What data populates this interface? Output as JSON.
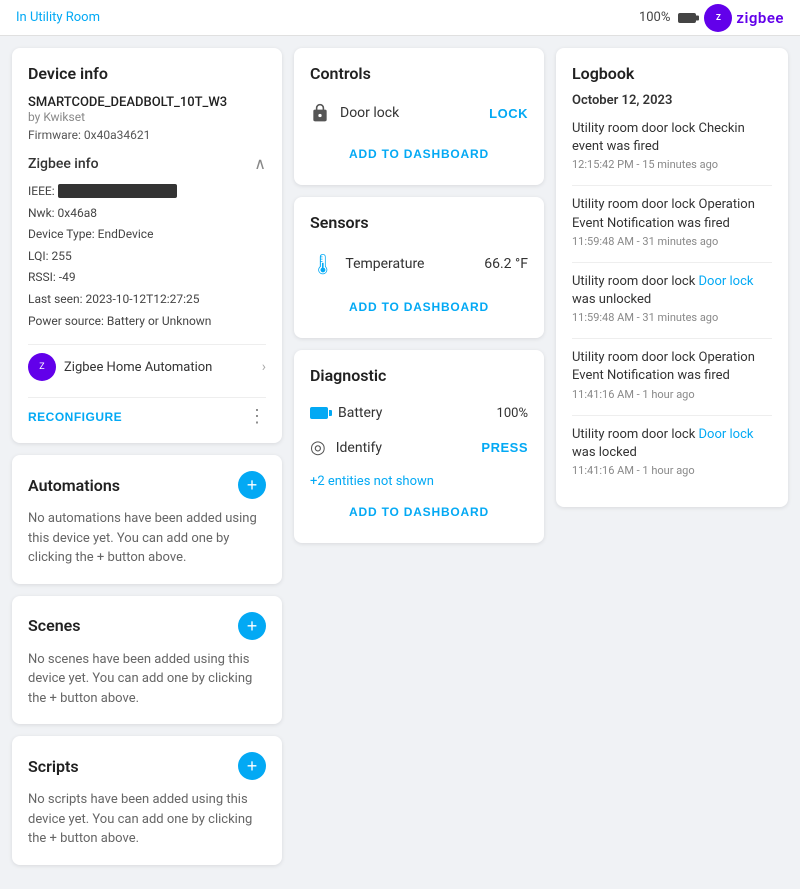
{
  "topbar": {
    "breadcrumb": "In Utility Room",
    "battery_pct": "100%",
    "zigbee_label": "zigbee"
  },
  "device_info": {
    "title": "Device info",
    "device_name": "SMARTCODE_DEADBOLT_10T_W3",
    "by": "by Kwikset",
    "firmware_label": "Firmware: 0x40a34621",
    "zigbee_info_title": "Zigbee info",
    "ieee_label": "IEEE:",
    "ieee_value": "██████████████",
    "nwk": "Nwk: 0x46a8",
    "device_type": "Device Type: EndDevice",
    "lqi": "LQI: 255",
    "rssi": "RSSI: -49",
    "last_seen": "Last seen: 2023-10-12T12:27:25",
    "power_source": "Power source: Battery or Unknown",
    "zigbee_home_label": "Zigbee Home Automation",
    "reconfigure_label": "RECONFIGURE"
  },
  "automations": {
    "title": "Automations",
    "empty_text": "No automations have been added using this device yet. You can add one by clicking the + button above."
  },
  "scenes": {
    "title": "Scenes",
    "empty_text": "No scenes have been added using this device yet. You can add one by clicking the + button above."
  },
  "scripts": {
    "title": "Scripts",
    "empty_text": "No scripts have been added using this device yet. You can add one by clicking the + button above."
  },
  "controls": {
    "title": "Controls",
    "door_lock_label": "Door lock",
    "lock_action": "LOCK",
    "add_dashboard": "ADD TO DASHBOARD"
  },
  "sensors": {
    "title": "Sensors",
    "temperature_label": "Temperature",
    "temperature_value": "66.2 °F",
    "add_dashboard": "ADD TO DASHBOARD"
  },
  "diagnostic": {
    "title": "Diagnostic",
    "battery_label": "Battery",
    "battery_value": "100%",
    "identify_label": "Identify",
    "press_action": "PRESS",
    "entities_link": "+2 entities not shown",
    "add_dashboard": "ADD TO DASHBOARD"
  },
  "logbook": {
    "title": "Logbook",
    "date": "October 12, 2023",
    "entries": [
      {
        "text_parts": [
          "Utility room door lock Checkin event was fired"
        ],
        "highlight": "",
        "time": "12:15:42 PM - 15 minutes ago"
      },
      {
        "text_parts": [
          "Utility room door lock Operation Event Notification was fired"
        ],
        "highlight": "",
        "time": "11:59:48 AM - 31 minutes ago"
      },
      {
        "text_parts": [
          "Utility room door lock Door lock was unlocked"
        ],
        "highlight": "Door lock",
        "time": "11:59:48 AM - 31 minutes ago"
      },
      {
        "text_parts": [
          "Utility room door lock Operation Event Notification was fired"
        ],
        "highlight": "",
        "time": "11:41:16 AM - 1 hour ago"
      },
      {
        "text_parts": [
          "Utility room door lock Door lock was locked"
        ],
        "highlight": "Door lock",
        "time": "11:41:16 AM - 1 hour ago"
      }
    ]
  }
}
